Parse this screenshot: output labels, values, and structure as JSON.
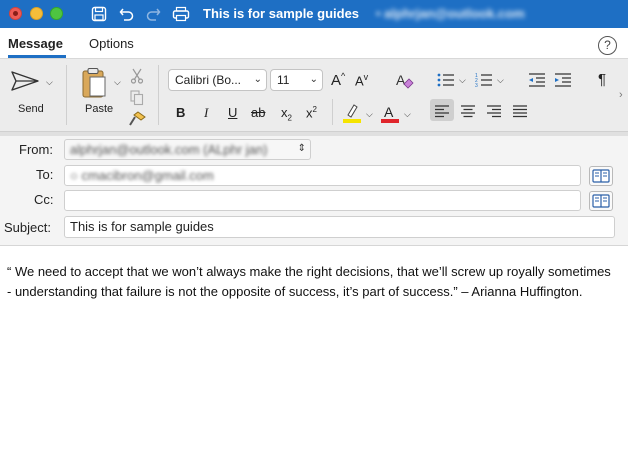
{
  "window": {
    "title": "This is for sample guides",
    "title_separator": " • ",
    "account": "alphrjan@outlook.com"
  },
  "tabs": [
    {
      "label": "Message",
      "active": true
    },
    {
      "label": "Options",
      "active": false
    }
  ],
  "help": {
    "glyph": "?"
  },
  "ribbon": {
    "send_label": "Send",
    "paste_label": "Paste",
    "font_name": "Calibri (Bo...",
    "font_size": "11",
    "bold": "B",
    "italic": "I",
    "underline": "U",
    "strike": "ab",
    "subscript": "x",
    "subscript_mark": "2",
    "superscript": "x",
    "superscript_mark": "2",
    "grow_font": "A",
    "shrink_font": "A",
    "highlight_color": "#f5e400",
    "font_color": "#e0252b",
    "alignment_selected": "left"
  },
  "fields": {
    "from_label": "From:",
    "from_value": "alphrjan@outlook.com (ALphr jan)",
    "to_label": "To:",
    "to_value": "cmacibron@gmail.com",
    "cc_label": "Cc:",
    "cc_value": "",
    "subject_label": "Subject:",
    "subject_value": "This is for sample guides"
  },
  "body": {
    "text": "“ We need to accept that we won’t always make the right decisions, that we’ll screw up royally sometimes - understanding that failure is not the opposite of success, it’s part of success.” – Arianna Huffington."
  },
  "colors": {
    "titlebar": "#1e6fc4",
    "accent": "#1e6fc4"
  }
}
